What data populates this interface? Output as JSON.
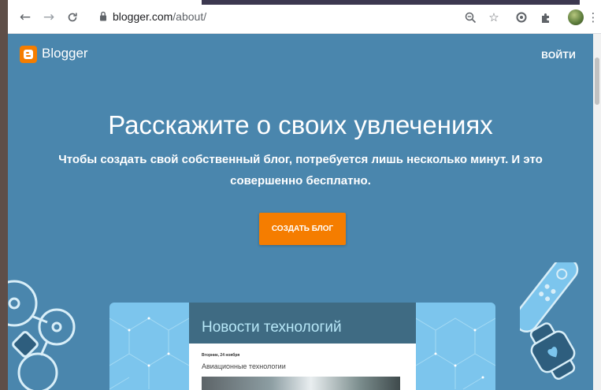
{
  "browser": {
    "back_icon": "arrow-left-icon",
    "forward_icon": "arrow-right-icon",
    "reload_icon": "reload-icon",
    "lock_icon": "lock-icon",
    "url_domain": "blogger.com",
    "url_path": "/about/",
    "toolbar_icons": [
      "zoom-icon",
      "star-icon",
      "extension-circle-icon",
      "puzzle-icon",
      "avatar",
      "menu-dots-icon"
    ]
  },
  "header": {
    "logo_text": "Blogger",
    "login_label": "ВОЙТИ"
  },
  "hero": {
    "headline": "Расскажите о своих увлечениях",
    "subhead": "Чтобы создать свой собственный блог, потребуется лишь несколько минут. И это совершенно бесплатно.",
    "cta_label": "СОЗДАТЬ БЛОГ"
  },
  "preview": {
    "blog_title": "Новости технологий",
    "post_date": "Вторник, 24 ноября",
    "post_title": "Авиационные технологии"
  },
  "colors": {
    "background": "#4a86ad",
    "accent": "#f57d00",
    "preview_light": "#7cc5ed",
    "preview_dark": "#3f6b83"
  }
}
